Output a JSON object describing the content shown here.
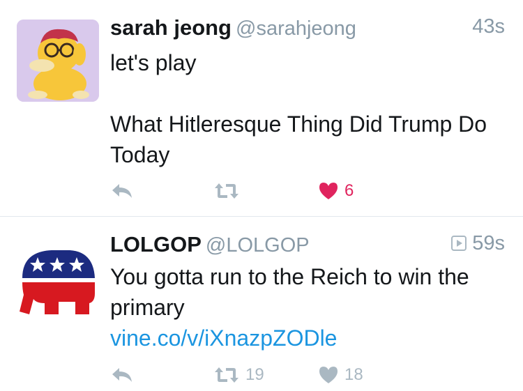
{
  "tweets": [
    {
      "display_name": "sarah jeong",
      "handle": "@sarahjeong",
      "time": "43s",
      "text_lines": [
        "let's play",
        "What Hitleresque Thing Did Trump Do Today"
      ],
      "retweet_count": "",
      "like_count": "6",
      "liked": true,
      "avatar": "psyduck-avatar-icon"
    },
    {
      "display_name": "LOLGOP",
      "handle": "@LOLGOP",
      "time": "59s",
      "text": "You gotta run to the Reich to win the primary",
      "link": "vine.co/v/iXnazpZODle",
      "retweet_count": "19",
      "like_count": "18",
      "liked": false,
      "avatar": "gop-elephant-icon"
    }
  ],
  "colors": {
    "text": "#14171a",
    "muted": "#8899a6",
    "icon": "#aab8c2",
    "like": "#e0245e",
    "link": "#1b95e0",
    "divider": "#e1e8ed"
  },
  "icons": {
    "reply": "reply-icon",
    "retweet": "retweet-icon",
    "like": "heart-icon",
    "vine": "vine-badge-icon"
  }
}
